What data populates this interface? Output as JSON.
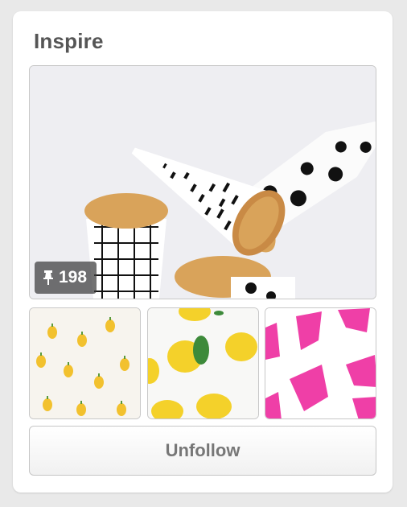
{
  "board": {
    "title": "Inspire",
    "pin_count": "198",
    "unfollow_label": "Unfollow"
  },
  "icons": {
    "pin": "pushpin-icon"
  },
  "colors": {
    "title": "#555555",
    "button_text": "#777777",
    "badge_bg": "#3c3c3c",
    "lemon_yellow": "#f2c12e",
    "accent_pink": "#ef3fa7"
  }
}
